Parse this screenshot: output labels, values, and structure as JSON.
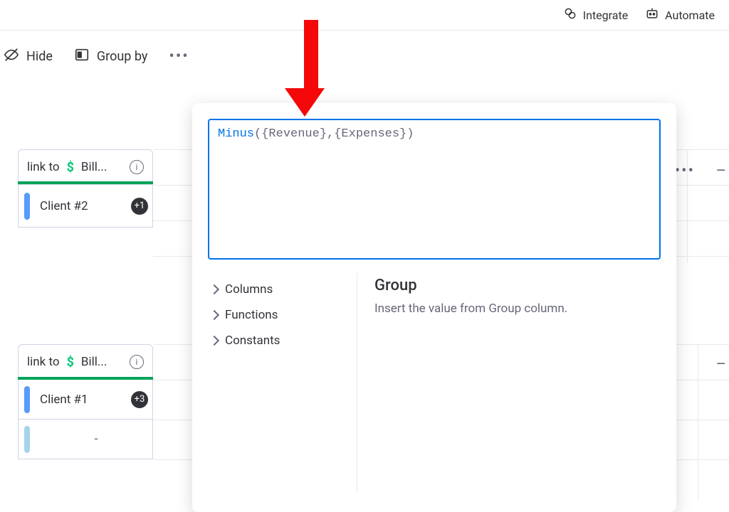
{
  "top": {
    "integrate": "Integrate",
    "automate": "Automate"
  },
  "toolbar": {
    "hide": "Hide",
    "group_by": "Group by"
  },
  "columns": {
    "link_to": "link to",
    "bill": "Bill..."
  },
  "group1": {
    "row1_name": "Client #2",
    "row1_badge": "+1"
  },
  "group2": {
    "row1_name": "Client #1",
    "row1_badge": "+3",
    "row2_name": "-"
  },
  "formula": {
    "fn": "Minus",
    "rest": "({Revenue},{Expenses})",
    "acc_columns": "Columns",
    "acc_functions": "Functions",
    "acc_constants": "Constants",
    "detail_title": "Group",
    "detail_desc": "Insert the value from Group column."
  }
}
